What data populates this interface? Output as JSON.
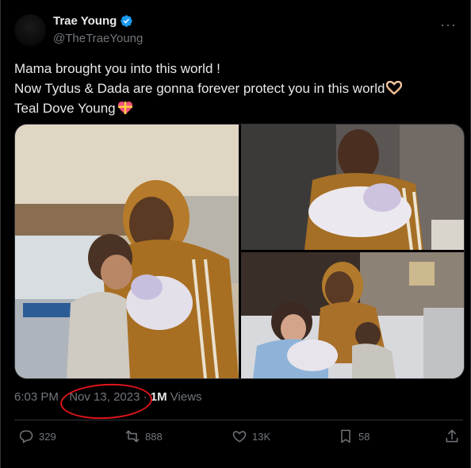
{
  "author": {
    "name": "Trae Young",
    "handle": "@TheTraeYoung"
  },
  "more_label": "···",
  "tweet": {
    "lines": [
      "Mama brought you into this world !",
      "Now Tydus & Dada are gonna forever protect you in this world",
      "Teal Dove Young"
    ]
  },
  "meta": {
    "time": "6:03 PM",
    "sep1": " · ",
    "date": "Nov 13, 2023",
    "sep2": " · ",
    "views_count": "1M",
    "views_label": " Views"
  },
  "actions": {
    "replies": "329",
    "reposts": "888",
    "likes": "13K",
    "bookmarks": "58"
  },
  "colors": {
    "background": "#000000",
    "text": "#e7e9ea",
    "secondary": "#71767b",
    "verified": "#1d9bf0",
    "annotation": "#e0141b"
  },
  "icons": [
    "verified-badge-icon",
    "more-icon",
    "heart-hands-emoji",
    "heart-gift-emoji",
    "reply-icon",
    "repost-icon",
    "like-icon",
    "bookmark-icon",
    "share-icon"
  ]
}
